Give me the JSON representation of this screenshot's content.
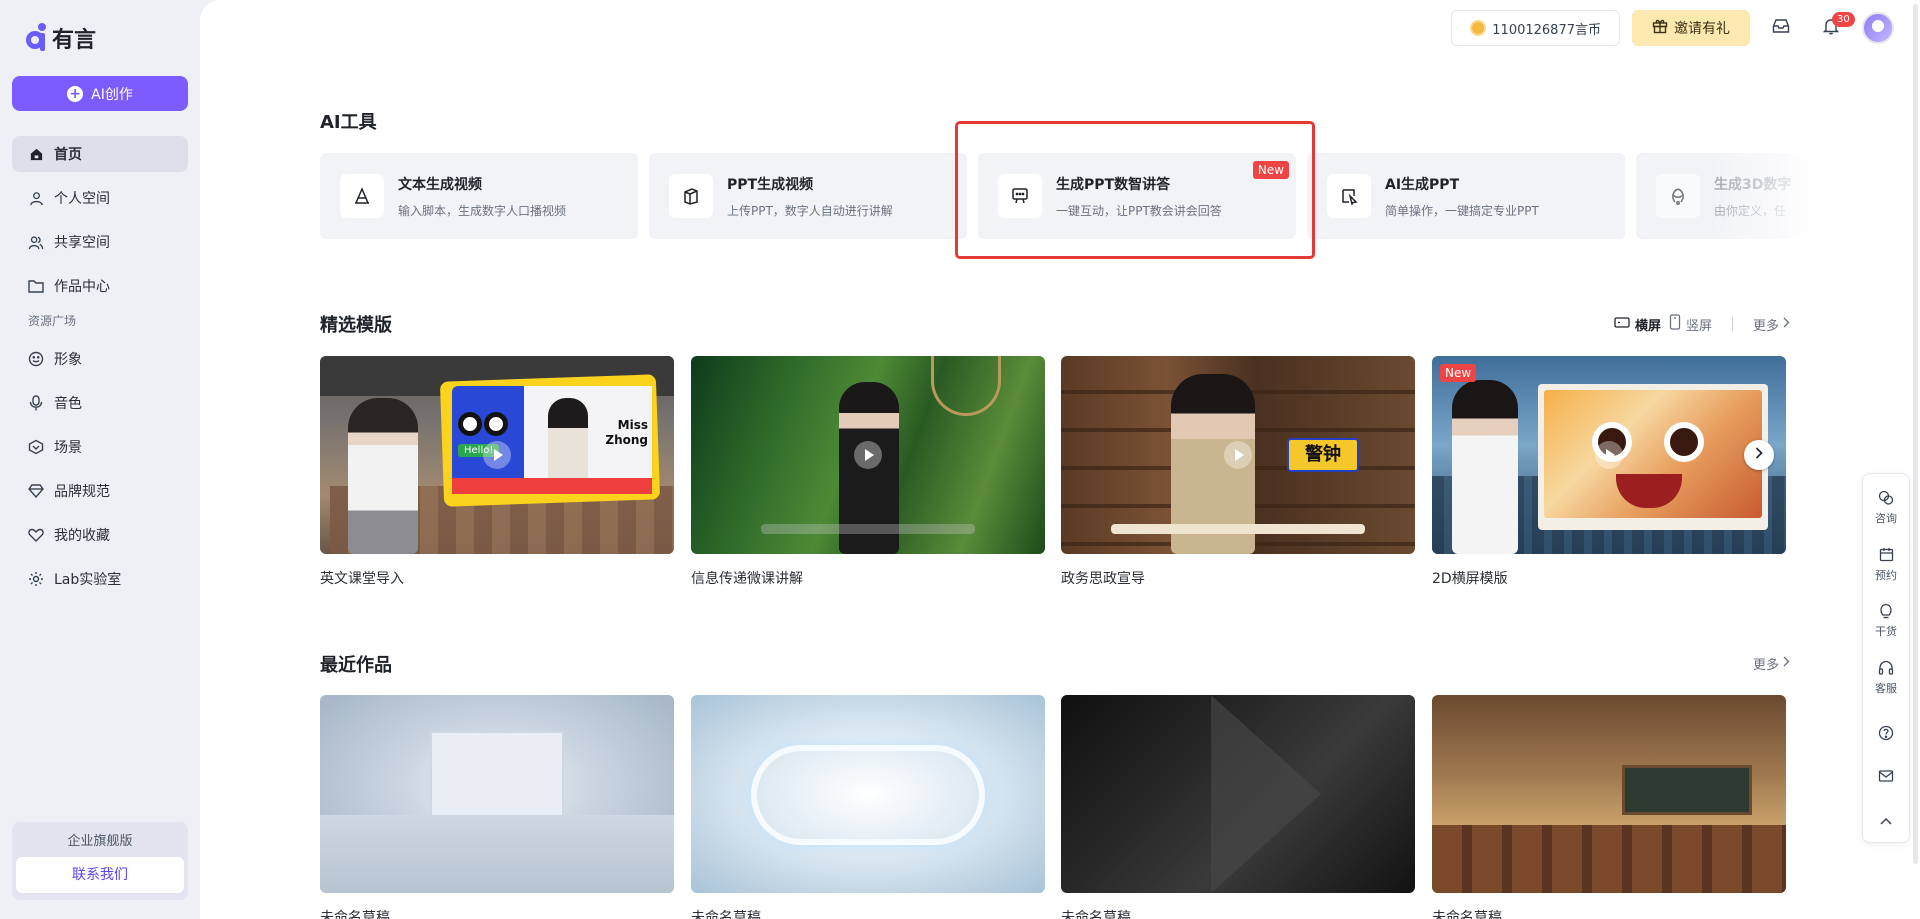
{
  "app": {
    "logo_text": "有言"
  },
  "sidebar": {
    "create_label": "AI创作",
    "items": [
      {
        "label": "首页",
        "icon": "home-icon",
        "active": true
      },
      {
        "label": "个人空间",
        "icon": "user-icon"
      },
      {
        "label": "共享空间",
        "icon": "users-icon"
      },
      {
        "label": "作品中心",
        "icon": "folder-icon"
      }
    ],
    "section_label": "资源广场",
    "resources": [
      {
        "label": "形象",
        "icon": "smile-icon"
      },
      {
        "label": "音色",
        "icon": "microphone-icon"
      },
      {
        "label": "场景",
        "icon": "scene-icon"
      },
      {
        "label": "品牌规范",
        "icon": "diamond-icon"
      },
      {
        "label": "我的收藏",
        "icon": "heart-icon"
      },
      {
        "label": "Lab实验室",
        "icon": "gear-icon"
      }
    ],
    "enterprise_title": "企业旗舰版",
    "contact_label": "联系我们"
  },
  "topbar": {
    "coins": "1100126877言币",
    "invite": "邀请有礼",
    "notification_count": "30"
  },
  "ai_tools": {
    "title": "AI工具",
    "cards": [
      {
        "title": "文本生成视频",
        "desc": "输入脚本，生成数字人口播视频",
        "icon": "text-a-icon"
      },
      {
        "title": "PPT生成视频",
        "desc": "上传PPT，数字人自动进行讲解",
        "icon": "ppt-icon"
      },
      {
        "title": "生成PPT数智讲答",
        "desc": "一键互动，让PPT教会讲会回答",
        "icon": "chat-screen-icon",
        "badge": "New"
      },
      {
        "title": "AI生成PPT",
        "desc": "简单操作，一键搞定专业PPT",
        "icon": "ai-ppt-icon"
      },
      {
        "title": "生成3D数字",
        "desc": "由你定义，任",
        "icon": "3d-icon"
      }
    ]
  },
  "templates": {
    "title": "精选模版",
    "landscape": "横屏",
    "portrait": "竖屏",
    "more": "更多",
    "cards": [
      {
        "caption": "英文课堂导入",
        "thumb_title": "Miss Zhong",
        "thumb_hello": "Hello!"
      },
      {
        "caption": "信息传递微课讲解"
      },
      {
        "caption": "政务思政宣导",
        "thumb_sign": "警钟"
      },
      {
        "caption": "2D横屏模版",
        "badge": "New"
      }
    ]
  },
  "recent": {
    "title": "最近作品",
    "more": "更多",
    "cards": [
      {
        "caption": "未命名草稿"
      },
      {
        "caption": "未命名草稿"
      },
      {
        "caption": "未命名草稿"
      },
      {
        "caption": "未命名草稿"
      }
    ]
  },
  "float_panel": {
    "items": [
      {
        "label": "咨询",
        "icon": "consult-icon"
      },
      {
        "label": "预约",
        "icon": "calendar-icon"
      },
      {
        "label": "干货",
        "icon": "bulb-icon"
      },
      {
        "label": "客服",
        "icon": "headset-icon"
      }
    ]
  }
}
